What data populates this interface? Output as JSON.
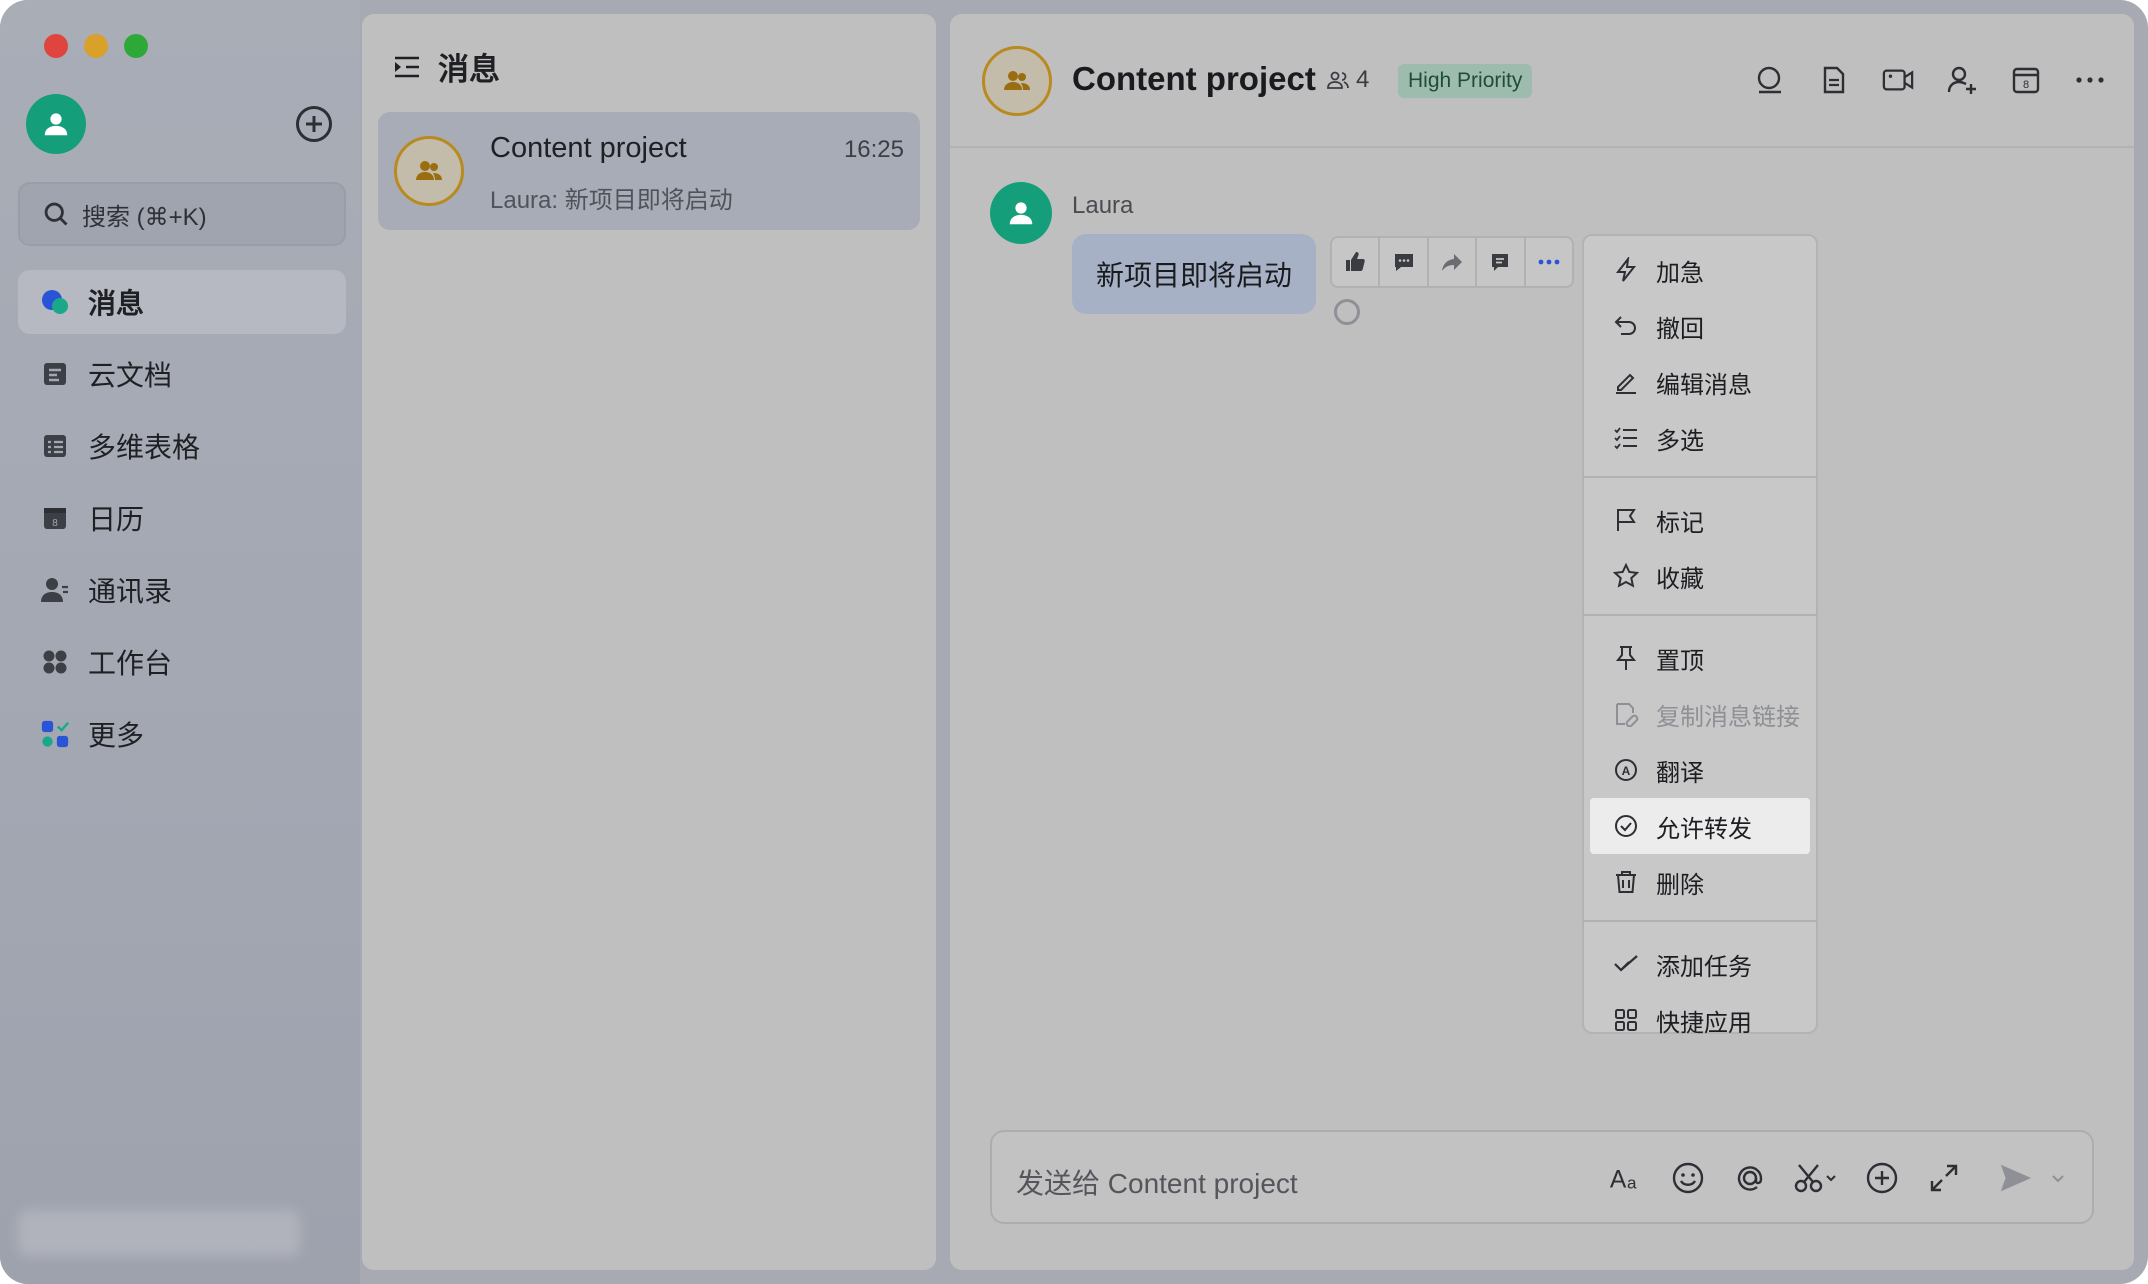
{
  "sidebar": {
    "search_placeholder": "搜索 (⌘+K)",
    "items": [
      {
        "label": "消息",
        "icon": "message-icon",
        "active": true
      },
      {
        "label": "云文档",
        "icon": "doc-icon"
      },
      {
        "label": "多维表格",
        "icon": "table-icon"
      },
      {
        "label": "日历",
        "icon": "calendar-icon"
      },
      {
        "label": "通讯录",
        "icon": "contacts-icon"
      },
      {
        "label": "工作台",
        "icon": "workplace-icon"
      },
      {
        "label": "更多",
        "icon": "more-apps-icon"
      }
    ]
  },
  "list": {
    "title": "消息",
    "chats": [
      {
        "name": "Content project",
        "time": "16:25",
        "preview": "Laura: 新项目即将启动"
      }
    ]
  },
  "chat": {
    "title": "Content project",
    "member_count": "4",
    "badge": "High Priority",
    "message": {
      "sender": "Laura",
      "text": "新项目即将启动"
    },
    "input_placeholder": "发送给 Content project"
  },
  "menu": {
    "groups": [
      [
        {
          "label": "加急",
          "icon": "lightning-icon"
        },
        {
          "label": "撤回",
          "icon": "undo-icon"
        },
        {
          "label": "编辑消息",
          "icon": "edit-icon"
        },
        {
          "label": "多选",
          "icon": "multi-select-icon"
        }
      ],
      [
        {
          "label": "标记",
          "icon": "flag-icon"
        },
        {
          "label": "收藏",
          "icon": "star-icon"
        }
      ],
      [
        {
          "label": "置顶",
          "icon": "pin-icon"
        },
        {
          "label": "复制消息链接",
          "icon": "link-icon",
          "disabled": true
        },
        {
          "label": "翻译",
          "icon": "translate-icon"
        },
        {
          "label": "允许转发",
          "icon": "check-circle-icon",
          "highlighted": true
        },
        {
          "label": "删除",
          "icon": "trash-icon"
        }
      ],
      [
        {
          "label": "添加任务",
          "icon": "task-icon"
        },
        {
          "label": "快捷应用",
          "icon": "apps-grid-icon"
        }
      ]
    ]
  },
  "colors": {
    "accent_green": "#159e7a",
    "group_ring": "#b88a1f",
    "badge_bg": "#9dbcae",
    "badge_text": "#1f4d3a"
  }
}
